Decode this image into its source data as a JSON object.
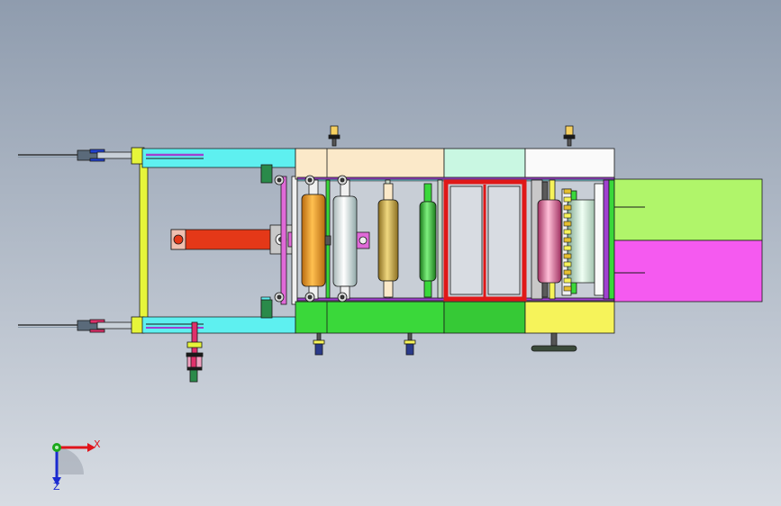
{
  "view": {
    "background_top": "#8f9cae",
    "background_bottom": "#d7dce3",
    "triad": {
      "x_label": "X",
      "z_label": "Z",
      "x_color": "#e0141b",
      "y_color": "#1aa81a",
      "z_color": "#1a2ad0"
    }
  },
  "model": {
    "colors": {
      "cyan": "#5ef0f0",
      "yellow_green": "#e6f53a",
      "cream": "#fbe9c9",
      "mint": "#c9f7e2",
      "white_box": "#fafafa",
      "green": "#3ad83a",
      "dark_green": "#36c936",
      "pale_yellow": "#f6f35a",
      "lime": "#b0f56a",
      "magenta": "#f55af0",
      "red_frame": "#e01818",
      "orange_roller": "#f0a020",
      "olive_roller": "#d4b24a",
      "green_roller": "#38c038",
      "pink_roller": "#f070a0",
      "red_arm": "#e43818",
      "purple_rail": "#a040d0",
      "outline": "#1a1a1a"
    },
    "icons": [
      "xyz-triad-icon"
    ]
  }
}
